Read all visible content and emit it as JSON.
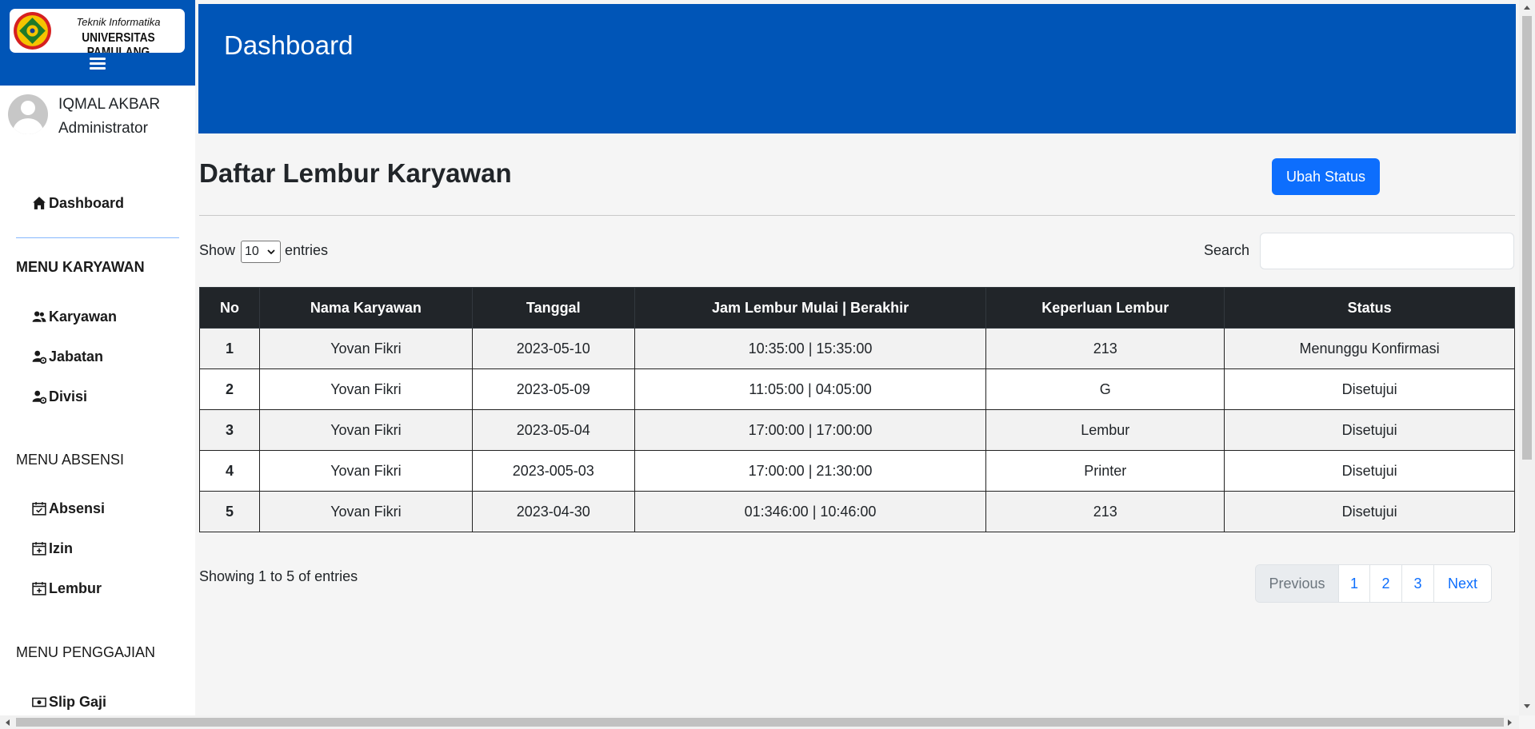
{
  "brand": {
    "line1": "Teknik Informatika",
    "line2": "UNIVERSITAS PAMULANG"
  },
  "user": {
    "name": "IQMAL AKBAR",
    "role": "Administrator"
  },
  "sidebar": {
    "dashboard": "Dashboard",
    "section_karyawan": "MENU KARYAWAN",
    "karyawan": "Karyawan",
    "jabatan": "Jabatan",
    "divisi": "Divisi",
    "section_absensi": "MENU ABSENSI",
    "absensi": "Absensi",
    "izin": "Izin",
    "lembur": "Lembur",
    "section_penggajian": "MENU PENGGAJIAN",
    "slip_gaji": "Slip Gaji"
  },
  "header": {
    "title": "Dashboard"
  },
  "main": {
    "title": "Daftar Lembur Karyawan",
    "ubah_status": "Ubah Status",
    "show_label": "Show",
    "entries_value": "10",
    "entries_label": "entries",
    "search_label": "Search",
    "search_value": "",
    "showing": "Showing 1 to 5 of entries"
  },
  "table": {
    "headers": [
      "No",
      "Nama Karyawan",
      "Tanggal",
      "Jam Lembur Mulai | Berakhir",
      "Keperluan Lembur",
      "Status"
    ],
    "rows": [
      [
        "1",
        "Yovan Fikri",
        "2023-05-10",
        "10:35:00 | 15:35:00",
        "213",
        "Menunggu Konfirmasi"
      ],
      [
        "2",
        "Yovan Fikri",
        "2023-05-09",
        "11:05:00 | 04:05:00",
        "G",
        "Disetujui"
      ],
      [
        "3",
        "Yovan Fikri",
        "2023-05-04",
        "17:00:00 | 17:00:00",
        "Lembur",
        "Disetujui"
      ],
      [
        "4",
        "Yovan Fikri",
        "2023-005-03",
        "17:00:00 | 21:30:00",
        "Printer",
        "Disetujui"
      ],
      [
        "5",
        "Yovan Fikri",
        "2023-04-30",
        "01:346:00 | 10:46:00",
        "213",
        "Disetujui"
      ]
    ]
  },
  "pagination": {
    "previous": "Previous",
    "pages": [
      "1",
      "2",
      "3"
    ],
    "next": "Next"
  },
  "colors": {
    "brand_blue": "#0055b7",
    "primary_button": "#0d6efd",
    "table_header": "#212529"
  }
}
